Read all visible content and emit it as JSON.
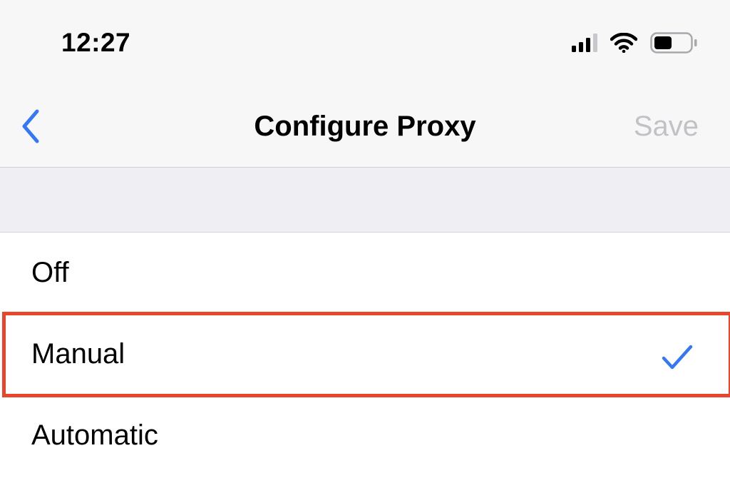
{
  "status_bar": {
    "time": "12:27",
    "icons": [
      "cellular-signal-icon",
      "wifi-icon",
      "battery-icon"
    ],
    "battery_level": 0.5
  },
  "nav_bar": {
    "back_icon": "chevron-left-icon",
    "title": "Configure Proxy",
    "save_label": "Save"
  },
  "options": [
    {
      "label": "Off",
      "selected": false
    },
    {
      "label": "Manual",
      "selected": true
    },
    {
      "label": "Automatic",
      "selected": false
    }
  ],
  "colors": {
    "accent": "#3478f6",
    "disabled_text": "#c2c2c6",
    "highlight": "#e8452a",
    "group_background": "#eeeef3"
  }
}
